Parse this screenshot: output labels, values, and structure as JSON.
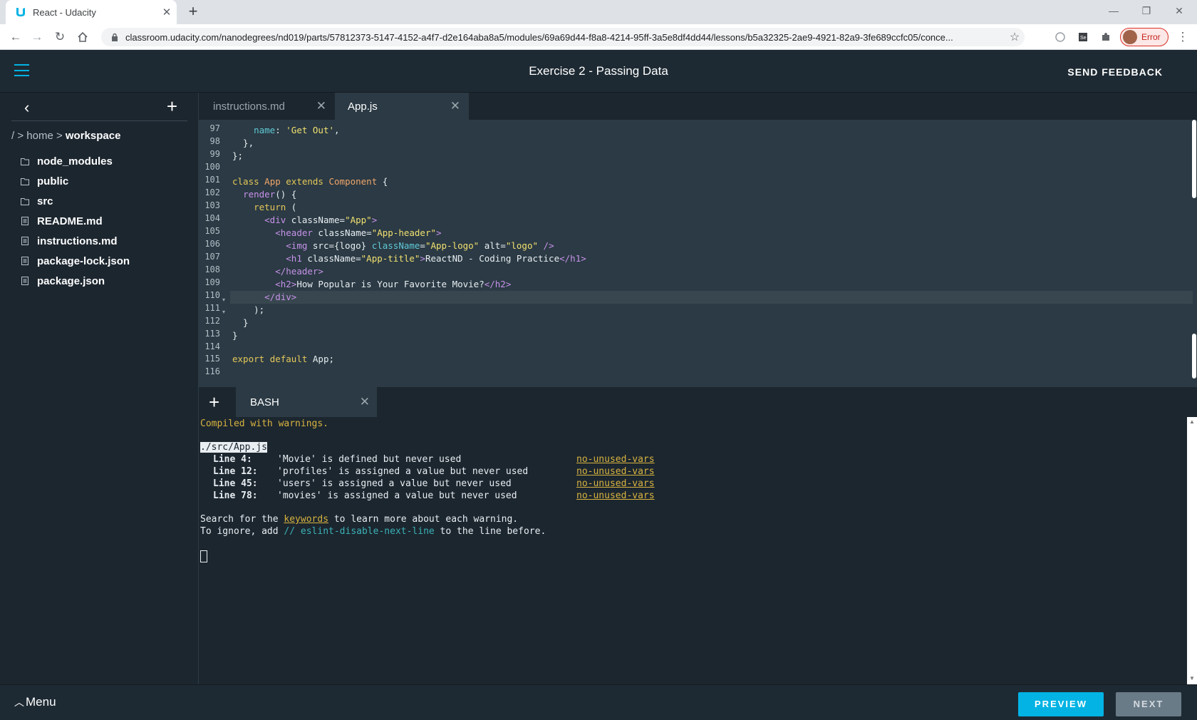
{
  "browser": {
    "tab_title": "React - Udacity",
    "url": "classroom.udacity.com/nanodegrees/nd019/parts/57812373-5147-4152-a4f7-d2e164aba8a5/modules/69a69d44-f8a8-4214-95ff-3a5e8df4dd44/lessons/b5a32325-2ae9-4921-82a9-3fe689ccfc05/conce...",
    "profile_status": "Error",
    "icons": [
      "udacity-favicon",
      "close-icon",
      "plus-icon",
      "back-icon",
      "forward-icon",
      "reload-icon",
      "home-icon",
      "lock-icon",
      "star-icon",
      "extension-icon",
      "puzzle-icon",
      "minimize-icon",
      "restore-icon",
      "close-window-icon"
    ]
  },
  "header": {
    "title": "Exercise 2 - Passing Data",
    "feedback_label": "SEND FEEDBACK"
  },
  "sidebar": {
    "breadcrumb_prefix": "/ > home > ",
    "breadcrumb_current": "workspace",
    "files": [
      {
        "name": "node_modules",
        "type": "folder"
      },
      {
        "name": "public",
        "type": "folder"
      },
      {
        "name": "src",
        "type": "folder"
      },
      {
        "name": "README.md",
        "type": "file"
      },
      {
        "name": "instructions.md",
        "type": "file"
      },
      {
        "name": "package-lock.json",
        "type": "file"
      },
      {
        "name": "package.json",
        "type": "file"
      }
    ]
  },
  "editor": {
    "tabs": [
      {
        "label": "instructions.md",
        "active": false
      },
      {
        "label": "App.js",
        "active": true
      }
    ],
    "line_numbers": [
      "97",
      "98",
      "99",
      "100",
      "101",
      "102",
      "103",
      "104",
      "105",
      "106",
      "107",
      "108",
      "109",
      "110",
      "111",
      "112",
      "113",
      "114",
      "115",
      "116"
    ],
    "active_line": "110"
  },
  "terminal": {
    "tab_label": "BASH",
    "compiled": "Compiled with warnings.",
    "file": "./src/App.js",
    "warnings": [
      {
        "line": "Line 4:",
        "message": "'Movie' is defined but never used",
        "rule": "no-unused-vars"
      },
      {
        "line": "Line 12:",
        "message": "'profiles' is assigned a value but never used",
        "rule": "no-unused-vars"
      },
      {
        "line": "Line 45:",
        "message": "'users' is assigned a value but never used",
        "rule": "no-unused-vars"
      },
      {
        "line": "Line 78:",
        "message": "'movies' is assigned a value but never used",
        "rule": "no-unused-vars"
      }
    ],
    "search_pre": "Search for the ",
    "search_link": "keywords",
    "search_post": " to learn more about each warning.",
    "ignore_pre": "To ignore, add ",
    "ignore_code": "// eslint-disable-next-line",
    "ignore_post": " to the line before."
  },
  "footer": {
    "menu_label": "Menu",
    "preview_label": "PREVIEW",
    "next_label": "NEXT"
  },
  "colors": {
    "accent": "#02b3e4",
    "background": "#1c262f",
    "editor_bg": "#2b3a44",
    "warning": "#d7b33f"
  }
}
